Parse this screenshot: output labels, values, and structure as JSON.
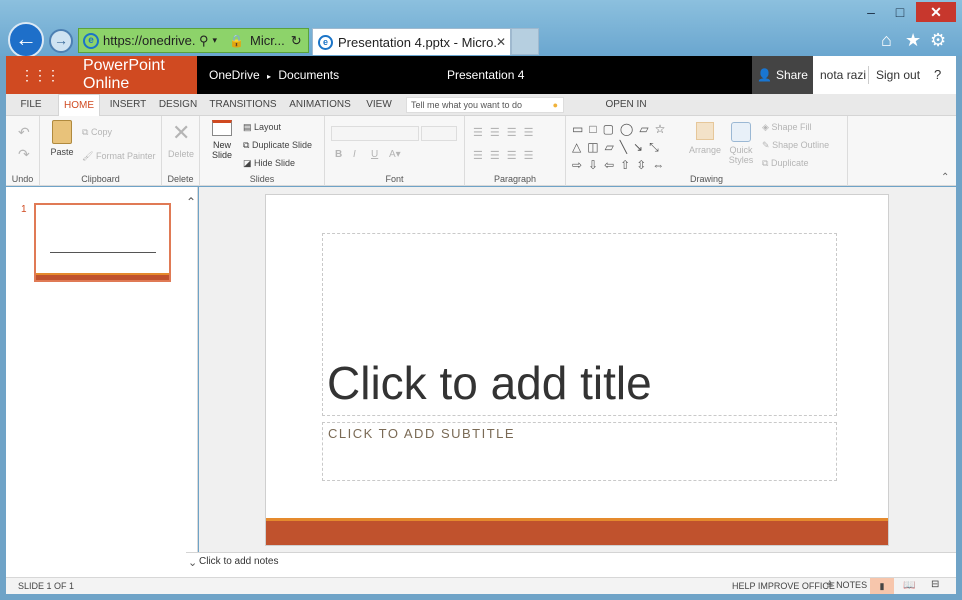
{
  "window": {
    "minimize": "–",
    "maximize": "□",
    "close": "✕"
  },
  "browser": {
    "address": "https://onedrive.l",
    "address_tab": "Micr...",
    "tab_title": "Presentation 4.pptx - Micro...",
    "home_icon": "home-icon",
    "favorites_icon": "star-icon",
    "tools_icon": "gear-icon"
  },
  "app": {
    "brand": "PowerPoint Online",
    "breadcrumb_root": "OneDrive",
    "breadcrumb_folder": "Documents",
    "doc_title": "Presentation 4",
    "share": "Share",
    "user": "nota razi",
    "sign_out": "Sign out",
    "help": "?"
  },
  "ribbon_tabs": [
    "FILE",
    "HOME",
    "INSERT",
    "DESIGN",
    "TRANSITIONS",
    "ANIMATIONS",
    "VIEW"
  ],
  "active_tab": "HOME",
  "tell_me_placeholder": "Tell me what you want to do",
  "open_in_app": "OPEN IN POWERPOINT",
  "ribbon": {
    "undo_group": "Undo",
    "clipboard": {
      "paste": "Paste",
      "copy": "Copy",
      "format_painter": "Format Painter",
      "label": "Clipboard"
    },
    "delete": {
      "button": "Delete",
      "label": "Delete"
    },
    "slides": {
      "new_slide": "New Slide",
      "layout": "Layout",
      "duplicate": "Duplicate Slide",
      "hide": "Hide Slide",
      "label": "Slides"
    },
    "font": {
      "label": "Font"
    },
    "paragraph": {
      "label": "Paragraph"
    },
    "drawing": {
      "arrange": "Arrange",
      "quick_styles": "Quick Styles",
      "shape_fill": "Shape Fill",
      "shape_outline": "Shape Outline",
      "duplicate": "Duplicate",
      "label": "Drawing"
    }
  },
  "thumbnails": [
    {
      "number": "1"
    }
  ],
  "slide": {
    "title_placeholder": "Click to add title",
    "subtitle_placeholder": "CLICK TO ADD SUBTITLE",
    "accent_color": "#c0522d"
  },
  "notes_placeholder": "Click to add notes",
  "status": {
    "slide_count": "SLIDE 1 OF 1",
    "help_improve": "HELP IMPROVE OFFICE",
    "notes": "NOTES"
  },
  "colors": {
    "brand": "#d04a21",
    "header": "#000000",
    "chrome": "#6fa3c7",
    "address_bar": "#8dd36a"
  }
}
